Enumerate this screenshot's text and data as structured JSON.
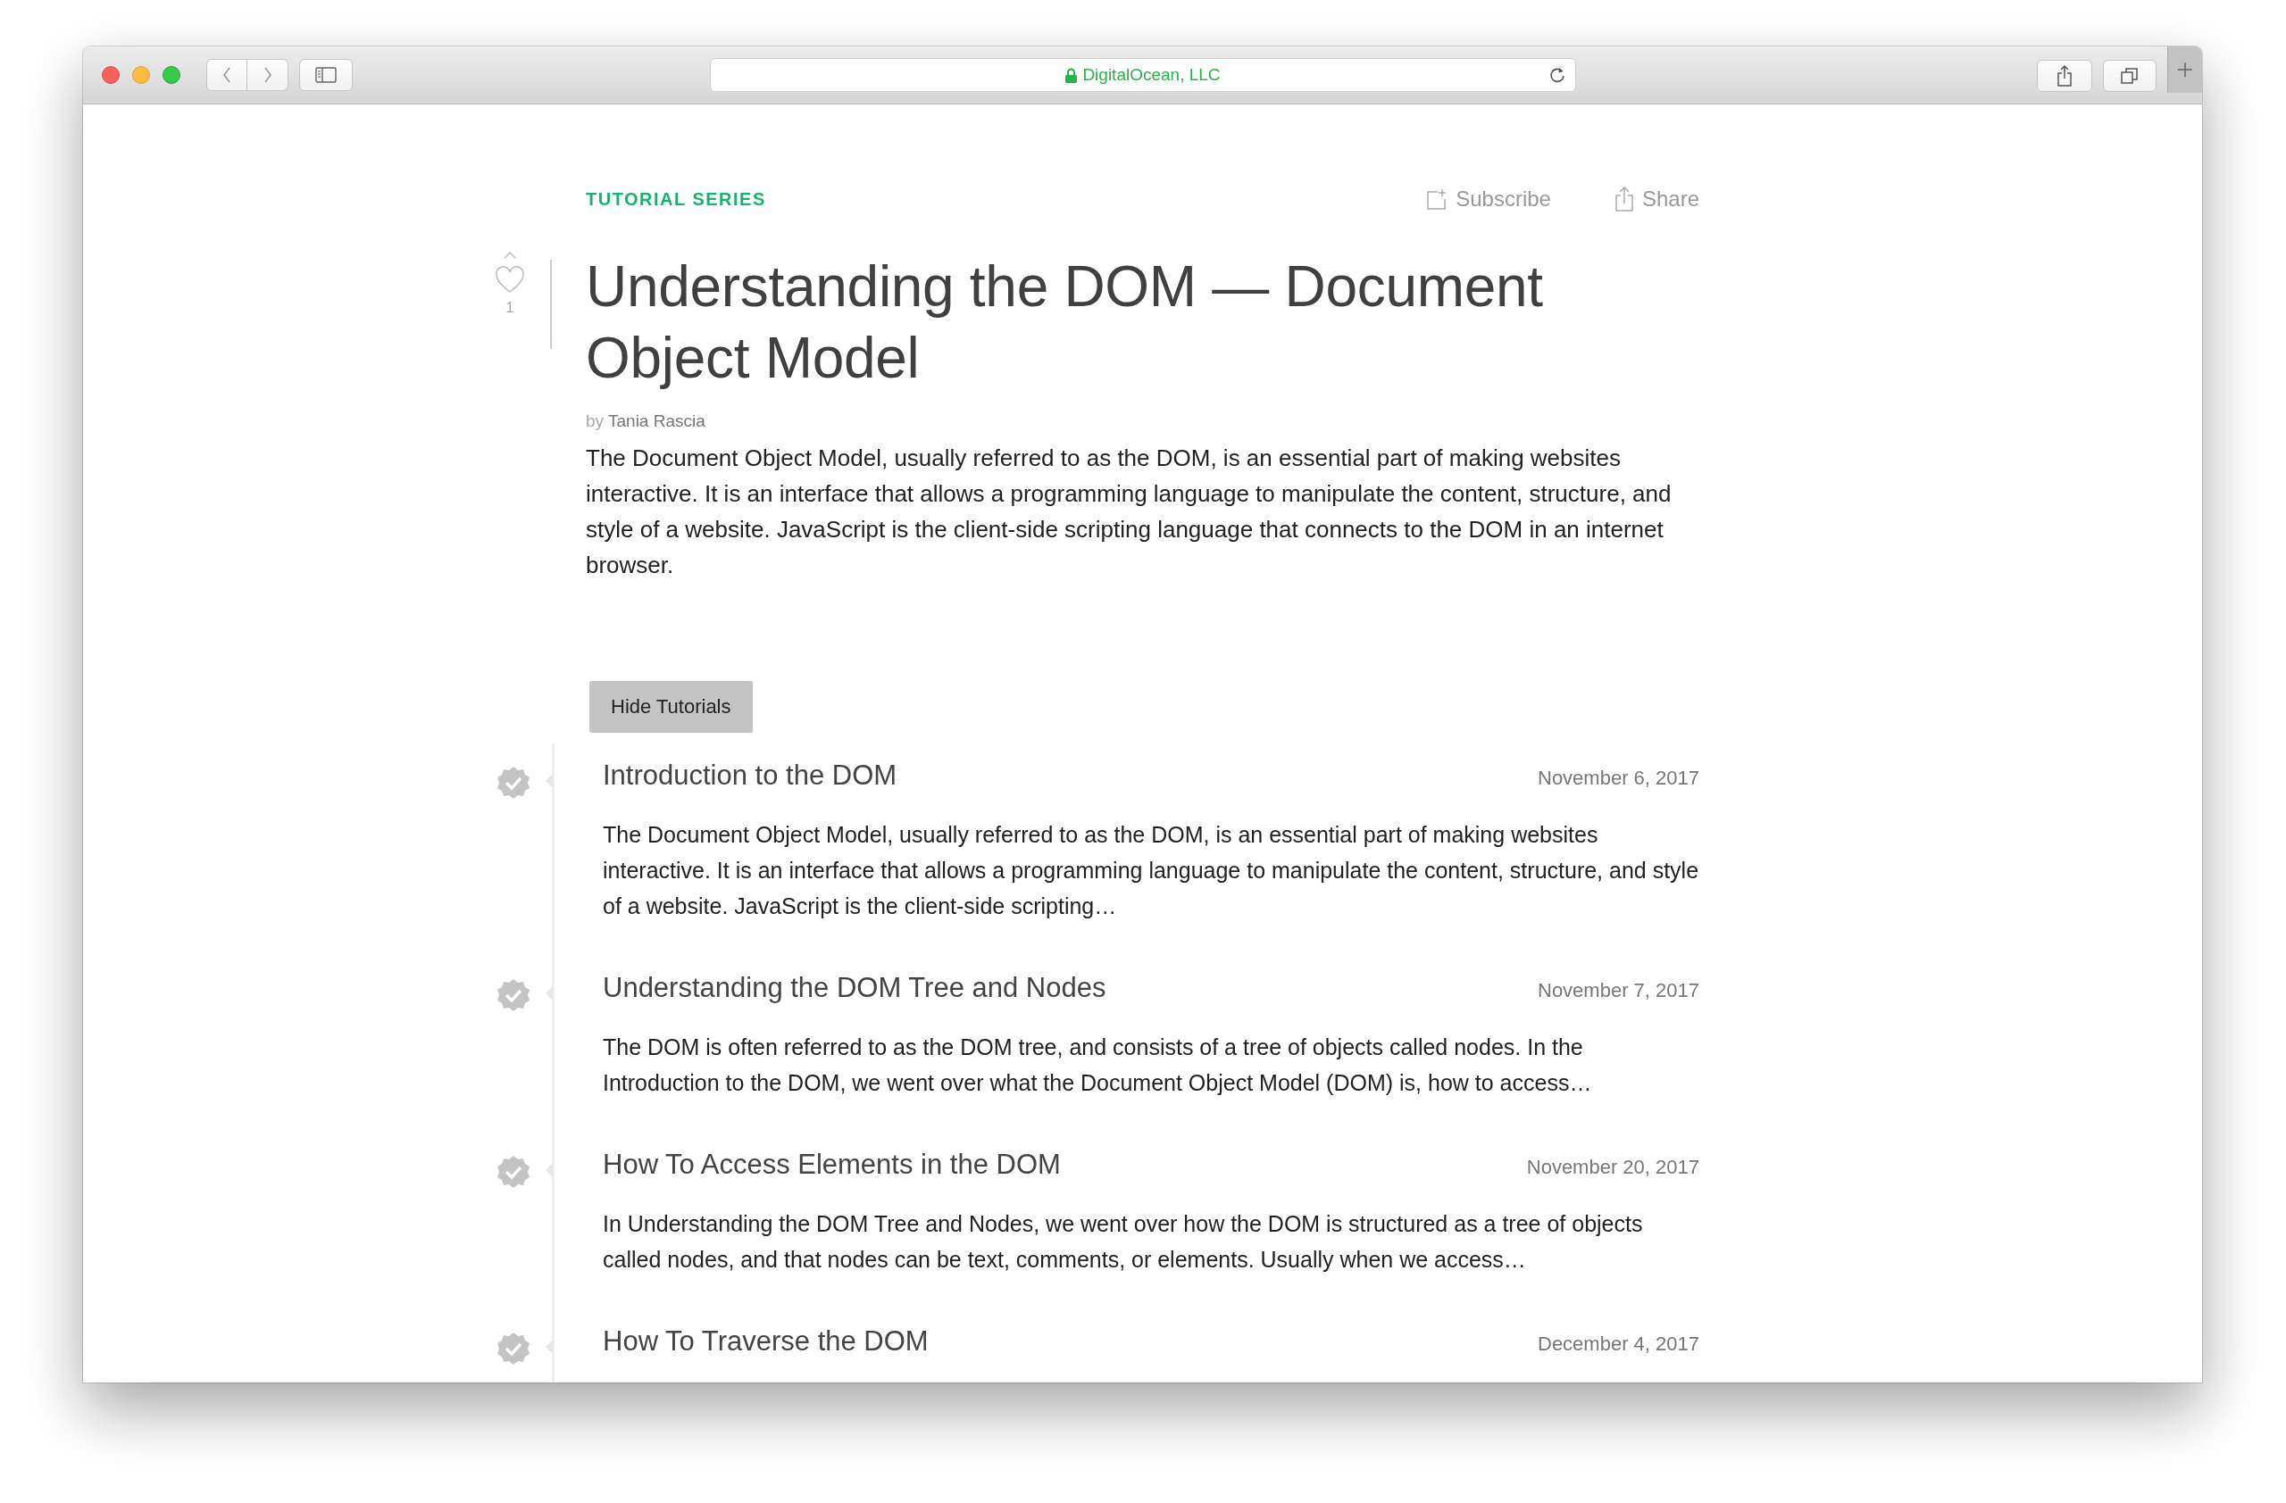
{
  "browser": {
    "address": "DigitalOcean, LLC",
    "secure": true
  },
  "series": {
    "label": "TUTORIAL SERIES",
    "actions": [
      {
        "kind": "subscribe",
        "label": "Subscribe"
      },
      {
        "kind": "share",
        "label": "Share"
      }
    ],
    "likes": "1",
    "title": "Understanding the DOM — Document Object Model",
    "byline_prefix": "by",
    "author": "Tania Rascia",
    "description": "The Document Object Model, usually referred to as the DOM, is an essential part of making websites interactive. It is an interface that allows a programming language to manipulate the content, structure, and style of a website. JavaScript is the client-side scripting language that connects to the DOM in an internet browser."
  },
  "toggle_button": "Hide Tutorials",
  "tutorials": [
    {
      "title": "Introduction to the DOM",
      "date": "November 6, 2017",
      "completed": true,
      "summary": "The Document Object Model, usually referred to as the DOM, is an essential part of making websites interactive. It is an interface that allows a programming language to manipulate the content, structure, and style of a website. JavaScript is the client-side scripting…"
    },
    {
      "title": "Understanding the DOM Tree and Nodes",
      "date": "November 7, 2017",
      "completed": true,
      "summary": "The DOM is often referred to as the DOM tree, and consists of a tree of objects called nodes. In the Introduction to the DOM, we went over what the Document Object Model (DOM) is, how to access…"
    },
    {
      "title": "How To Access Elements in the DOM",
      "date": "November 20, 2017",
      "completed": true,
      "summary": "In Understanding the DOM Tree and Nodes, we went over how the DOM is structured as a tree of objects called nodes, and that nodes can be text, comments, or elements. Usually when we access…"
    },
    {
      "title": "How To Traverse the DOM",
      "date": "December 4, 2017",
      "completed": true
    }
  ]
}
